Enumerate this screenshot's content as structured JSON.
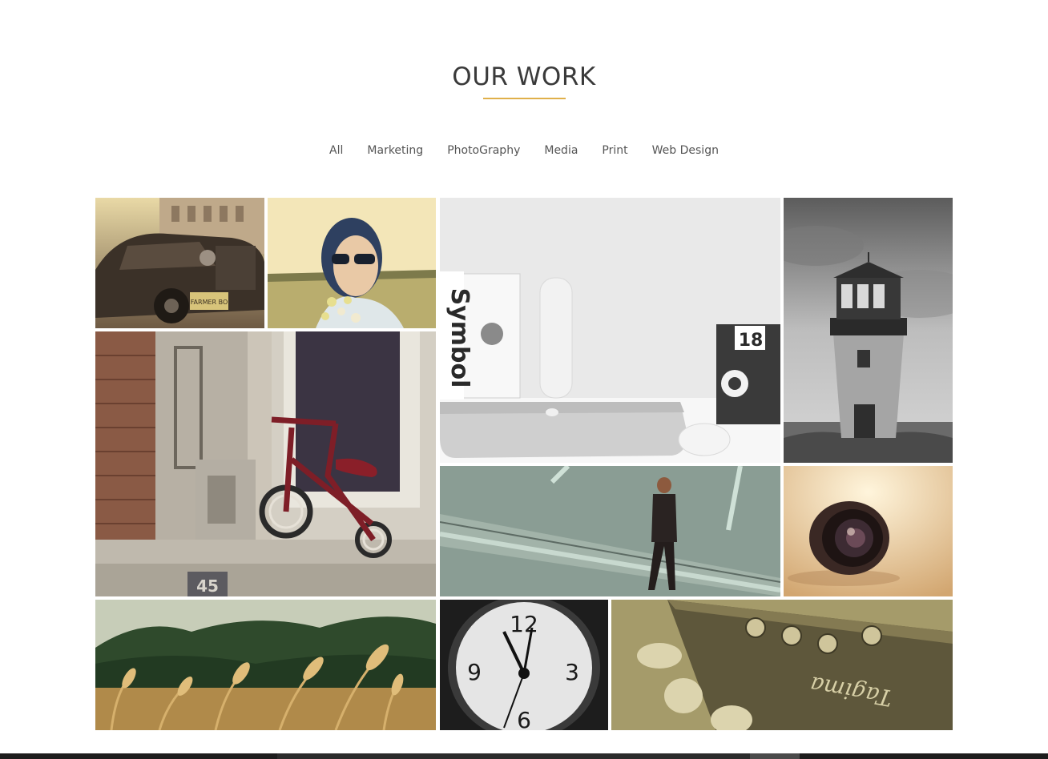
{
  "section": {
    "title": "OUR WORK",
    "accent_color": "#e0b04a"
  },
  "filters": [
    {
      "label": "All"
    },
    {
      "label": "Marketing"
    },
    {
      "label": "PhotoGraphy"
    },
    {
      "label": "Media"
    },
    {
      "label": "Print"
    },
    {
      "label": "Web Design"
    }
  ],
  "gallery": {
    "items": [
      {
        "subject": "vintage-car"
      },
      {
        "subject": "girl-sunglasses"
      },
      {
        "subject": "desk-laptop"
      },
      {
        "subject": "lighthouse"
      },
      {
        "subject": "tricycle"
      },
      {
        "subject": "man-walking"
      },
      {
        "subject": "camera-lens"
      },
      {
        "subject": "wheat-field"
      },
      {
        "subject": "clock"
      },
      {
        "subject": "guitar-headstock"
      }
    ],
    "image_texts": {
      "car_plate": "FARMER BO",
      "book_title": "Symbol",
      "calendar_number": "18",
      "curb_number": "45",
      "clock_numbers": [
        "12",
        "3",
        "6",
        "9"
      ],
      "guitar_brand": "Tagima"
    }
  }
}
